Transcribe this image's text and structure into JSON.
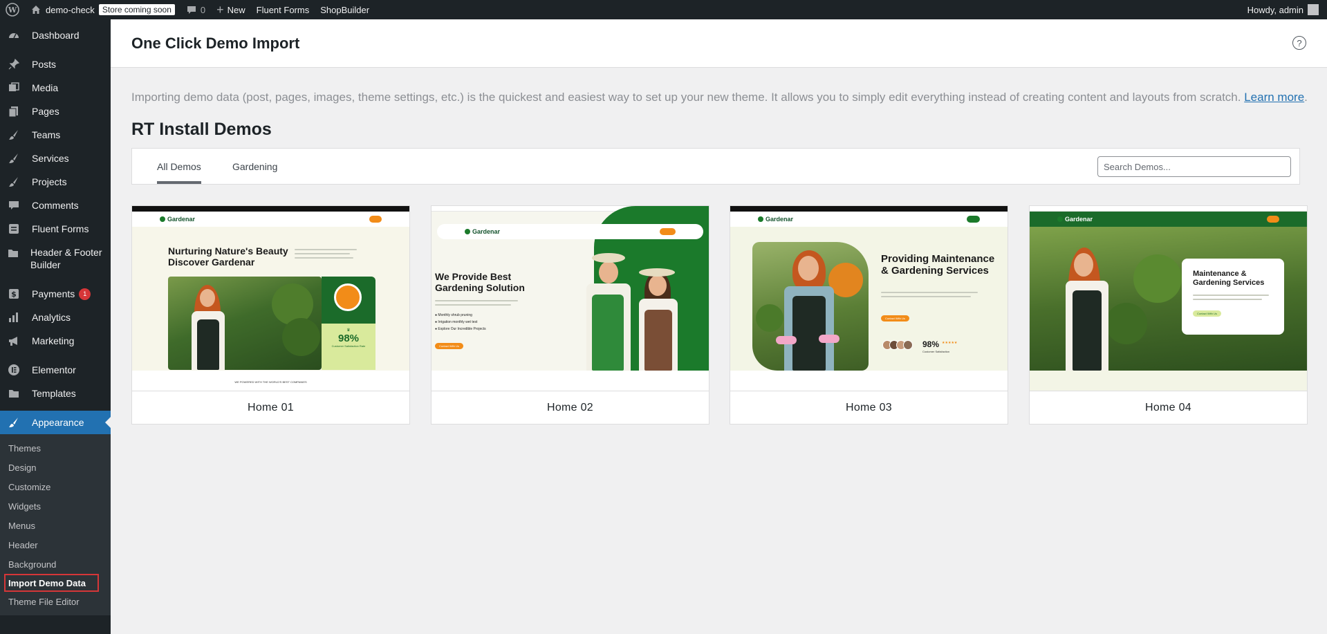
{
  "admin_bar": {
    "site_name": "demo-check",
    "store_badge": "Store coming soon",
    "comments_count": "0",
    "new_label": "New",
    "fluent_forms": "Fluent Forms",
    "shop_builder": "ShopBuilder",
    "howdy": "Howdy, admin"
  },
  "sidebar": {
    "items": [
      {
        "label": "Dashboard",
        "icon": "dashboard-icon"
      },
      {
        "label": "Posts",
        "icon": "pin-icon"
      },
      {
        "label": "Media",
        "icon": "media-icon"
      },
      {
        "label": "Pages",
        "icon": "pages-icon"
      },
      {
        "label": "Teams",
        "icon": "brush-icon"
      },
      {
        "label": "Services",
        "icon": "brush-icon"
      },
      {
        "label": "Projects",
        "icon": "brush-icon"
      },
      {
        "label": "Comments",
        "icon": "comment-icon"
      },
      {
        "label": "Fluent Forms",
        "icon": "forms-icon"
      },
      {
        "label": "Header & Footer Builder",
        "icon": "folder-icon"
      },
      {
        "label": "Payments",
        "icon": "dollar-icon",
        "badge": "1"
      },
      {
        "label": "Analytics",
        "icon": "chart-icon"
      },
      {
        "label": "Marketing",
        "icon": "megaphone-icon"
      },
      {
        "label": "Elementor",
        "icon": "elementor-icon"
      },
      {
        "label": "Templates",
        "icon": "folder-icon"
      },
      {
        "label": "Appearance",
        "icon": "paintbrush-icon"
      }
    ],
    "submenu": [
      "Themes",
      "Design",
      "Customize",
      "Widgets",
      "Menus",
      "Header",
      "Background",
      "Import Demo Data",
      "Theme File Editor"
    ]
  },
  "page": {
    "title": "One Click Demo Import",
    "intro": "Importing demo data (post, pages, images, theme settings, etc.) is the quickest and easiest way to set up your new theme. It allows you to simply edit everything instead of creating content and layouts from scratch. ",
    "learn_more": "Learn more",
    "period": ".",
    "section_title": "RT Install Demos"
  },
  "filters": {
    "tabs": [
      "All Demos",
      "Gardening"
    ],
    "active_tab": "All Demos",
    "search_placeholder": "Search Demos..."
  },
  "demos": [
    {
      "title": "Home 01",
      "headline": "Nurturing Nature's Beauty Discover Gardenar",
      "stat": "98%",
      "stat_label": "Customer Satisfaction Rate",
      "footer_text": "WE POWERED WITH THE WORLD'S BEST COMPANIES",
      "logo": "Gardenar"
    },
    {
      "title": "Home 02",
      "headline": "We Provide Best Gardening Solution",
      "bullets": [
        "Monthly shrub pruning",
        "Irrigation monthly wet test",
        "Explore Our Incredible Projects"
      ],
      "cta": "Contact With Us",
      "logo": "Gardenar"
    },
    {
      "title": "Home 03",
      "headline": "Providing Maintenance & Gardening Services",
      "stat": "98%",
      "stat_label": "Customer Satisfaction",
      "cta": "Contact With Us",
      "logo": "Gardenar"
    },
    {
      "title": "Home 04",
      "headline": "Maintenance & Gardening Services",
      "cta": "Contact With Us",
      "logo": "Gardenar"
    }
  ],
  "colors": {
    "admin_dark": "#1d2327",
    "accent_blue": "#2271b1",
    "brand_green": "#1b7a2b",
    "brand_orange": "#f28c18",
    "highlight_red": "#d63638"
  }
}
